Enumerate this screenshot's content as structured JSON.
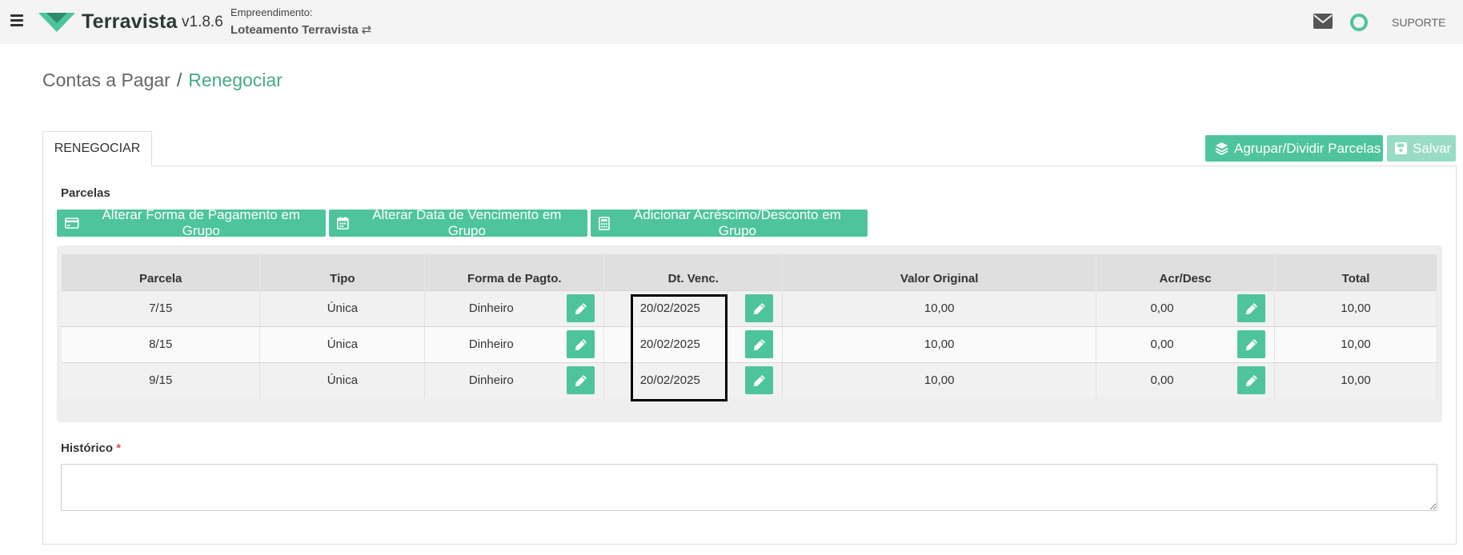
{
  "header": {
    "brand": "Terravista",
    "version": "v1.8.6",
    "empreendimento_label": "Empreendimento:",
    "empreendimento_name": "Loteamento Terravista",
    "support_label": "SUPORTE",
    "icons": [
      "menu-icon",
      "logo-icon",
      "swap-icon",
      "mail-icon",
      "status-icon"
    ],
    "accent_color": "#4ec49c"
  },
  "breadcrumb": {
    "parent": "Contas a Pagar",
    "separator": "/",
    "current": "Renegociar"
  },
  "tab": {
    "label": "RENEGOCIAR"
  },
  "actions": {
    "agrupar_label": "Agrupar/Dividir Parcelas",
    "salvar_label": "Salvar"
  },
  "parcelas": {
    "label": "Parcelas",
    "group_buttons": [
      {
        "label": "Alterar Forma de Pagamento em Grupo",
        "icon": "credit-card-icon"
      },
      {
        "label": "Alterar Data de Vencimento em Grupo",
        "icon": "calendar-icon"
      },
      {
        "label": "Adicionar Acréscimo/Desconto em Grupo",
        "icon": "calculator-icon"
      }
    ],
    "columns": [
      "Parcela",
      "Tipo",
      "Forma de Pagto.",
      "Dt. Venc.",
      "Valor Original",
      "Acr/Desc",
      "Total"
    ],
    "rows": [
      {
        "parcela": "7/15",
        "tipo": "Única",
        "forma": "Dinheiro",
        "vencimento": "20/02/2025",
        "valor_original": "10,00",
        "acr_desc": "0,00",
        "total": "10,00"
      },
      {
        "parcela": "8/15",
        "tipo": "Única",
        "forma": "Dinheiro",
        "vencimento": "20/02/2025",
        "valor_original": "10,00",
        "acr_desc": "0,00",
        "total": "10,00"
      },
      {
        "parcela": "9/15",
        "tipo": "Única",
        "forma": "Dinheiro",
        "vencimento": "20/02/2025",
        "valor_original": "10,00",
        "acr_desc": "0,00",
        "total": "10,00"
      }
    ]
  },
  "historico": {
    "label": "Histórico",
    "required_mark": "*",
    "value": ""
  }
}
